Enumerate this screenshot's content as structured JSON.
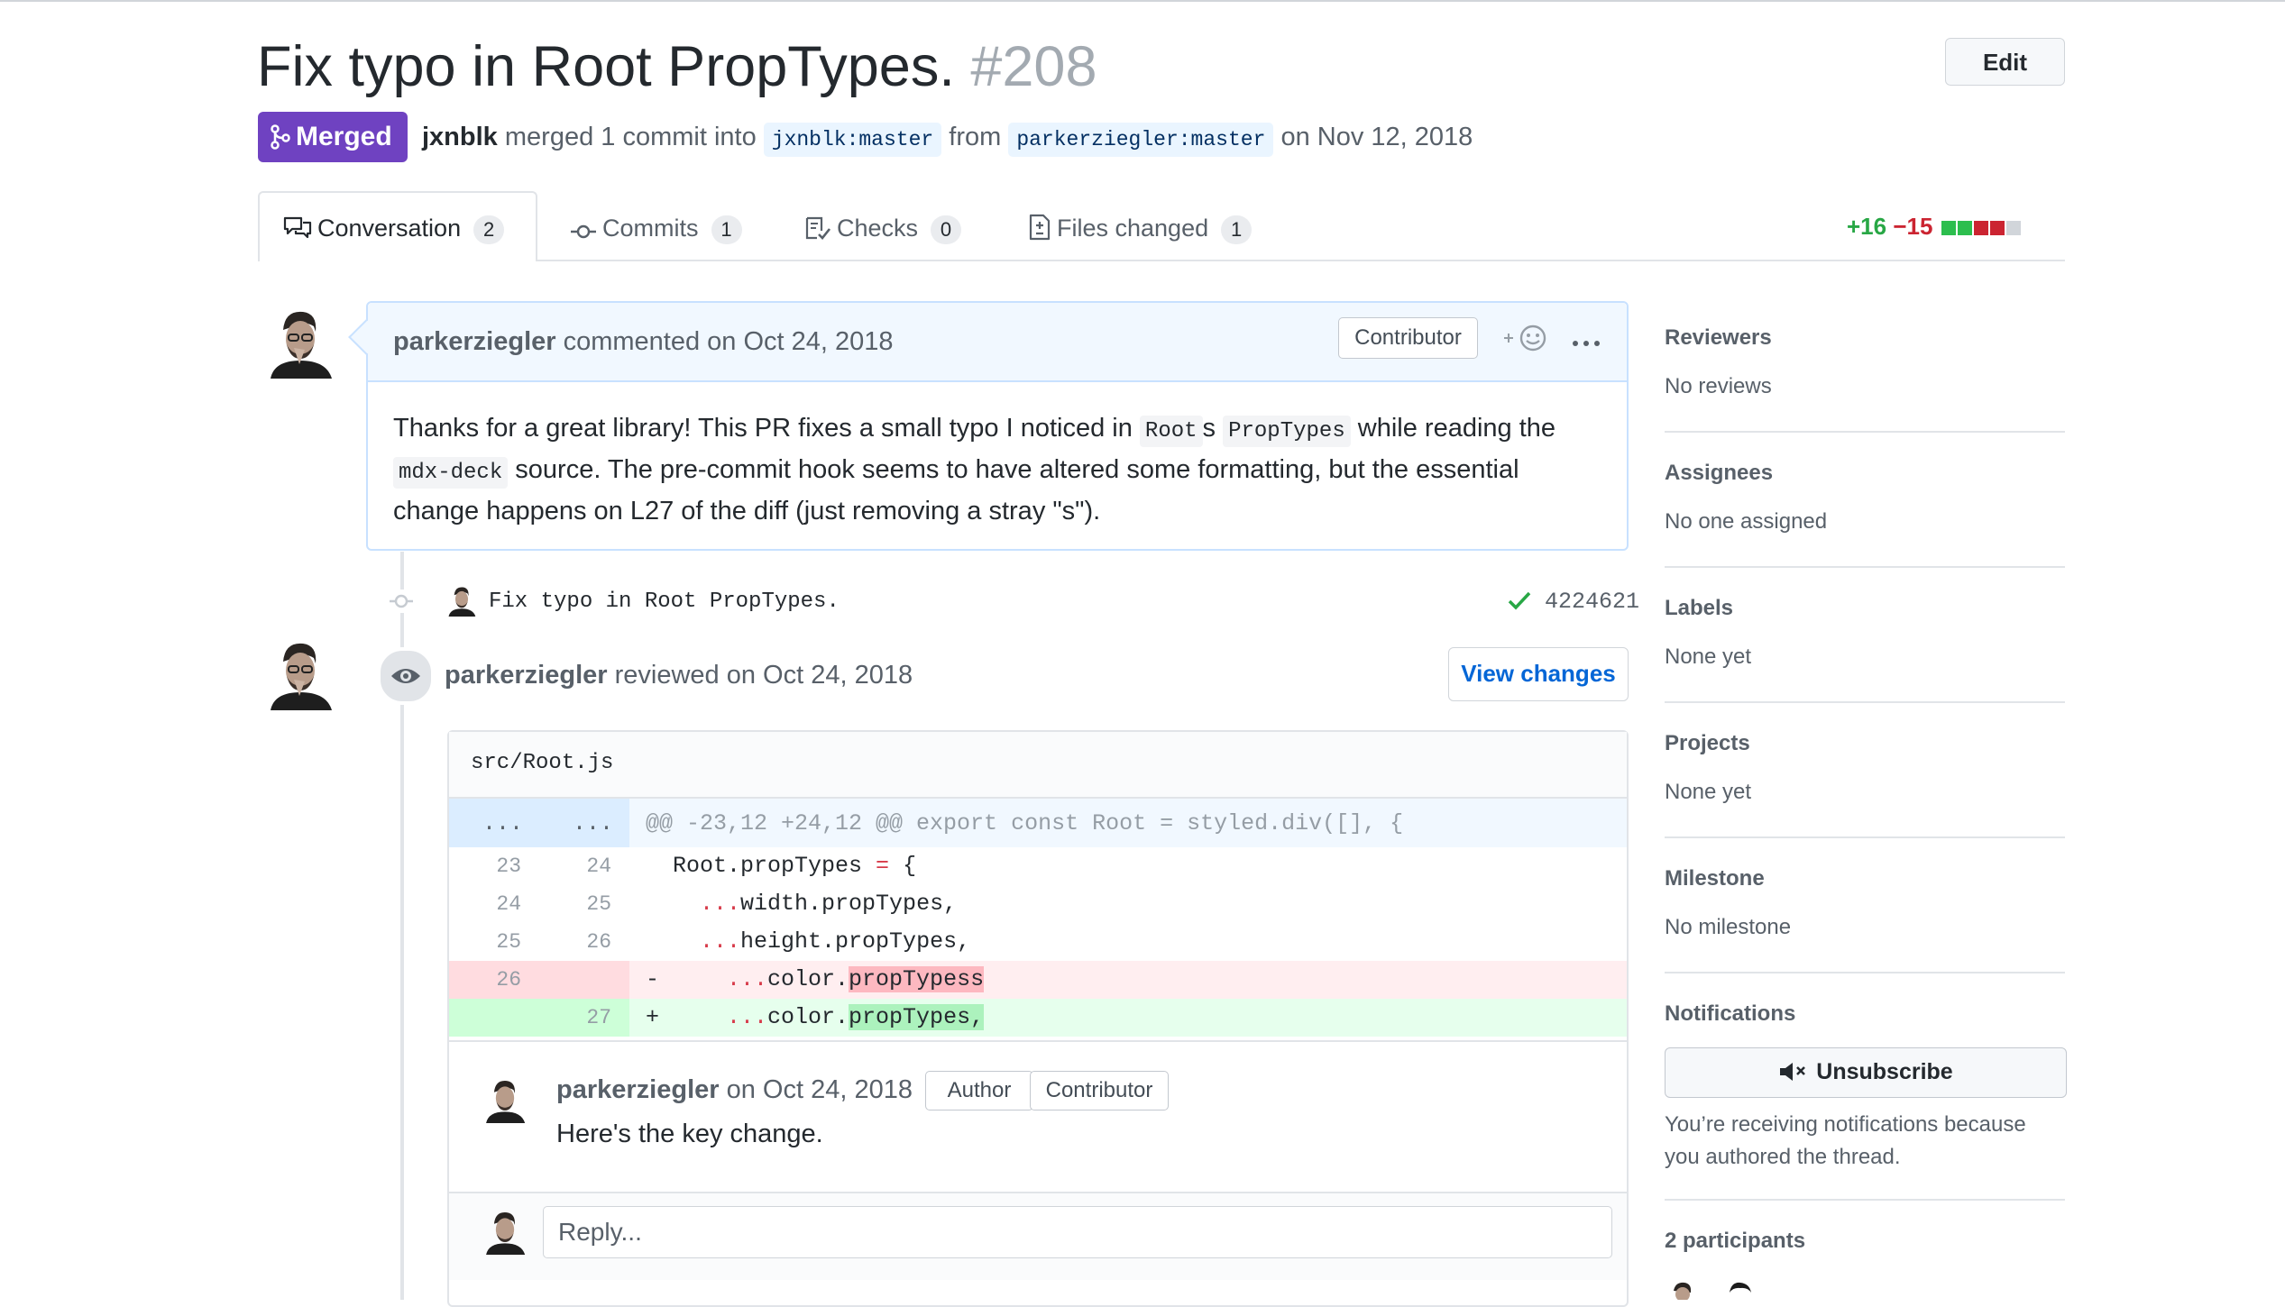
{
  "pr": {
    "title": "Fix typo in Root PropTypes.",
    "number": "#208",
    "edit_label": "Edit",
    "state_label": "Merged",
    "merger": "jxnblk",
    "merge_text": "merged 1 commit into",
    "base_branch": "jxnblk:master",
    "from_text": "from",
    "head_branch": "parkerziegler:master",
    "date_text": "on Nov 12, 2018"
  },
  "tabs": [
    {
      "label": "Conversation",
      "count": "2",
      "icon": "comment-discussion-icon"
    },
    {
      "label": "Commits",
      "count": "1",
      "icon": "git-commit-icon"
    },
    {
      "label": "Checks",
      "count": "0",
      "icon": "checklist-icon"
    },
    {
      "label": "Files changed",
      "count": "1",
      "icon": "file-diff-icon"
    }
  ],
  "diffstat": {
    "additions": "+16",
    "deletions": "−15"
  },
  "comment": {
    "author": "parkerziegler",
    "action": "commented on Oct 24, 2018",
    "label": "Contributor",
    "body_part1": "Thanks for a great library! This PR fixes a small typo I noticed in ",
    "code1": "Root",
    "body_part2": "s ",
    "code2": "PropTypes",
    "body_part3": " while reading the ",
    "code3": "mdx-deck",
    "body_part4": " source. The pre-commit hook seems to have altered some formatting, but the essential change happens on L27 of the diff (just removing a stray \"s\")."
  },
  "commit": {
    "message": "Fix typo in Root PropTypes.",
    "sha": "4224621"
  },
  "review": {
    "author": "parkerziegler",
    "action": "reviewed on Oct 24, 2018",
    "view_button": "View changes",
    "file_path": "src/Root.js",
    "hunk_left": "...",
    "hunk_right": "...",
    "hunk_header": "@@ -23,12 +24,12 @@ export const Root = styled.div([], {",
    "lines": [
      {
        "old": "23",
        "new": "24",
        "sign": "",
        "code": "  Root.propTypes = {"
      },
      {
        "old": "24",
        "new": "25",
        "sign": "",
        "code": "    ...width.propTypes,"
      },
      {
        "old": "25",
        "new": "26",
        "sign": "",
        "code": "    ...height.propTypes,"
      },
      {
        "old": "26",
        "new": "",
        "sign": "-",
        "code": "    ...color.propTypess"
      },
      {
        "old": "",
        "new": "27",
        "sign": "+",
        "code": "    ...color.propTypes,"
      }
    ],
    "inline_comment": {
      "author": "parkerziegler",
      "date": "on Oct 24, 2018",
      "labels": [
        "Author",
        "Contributor"
      ],
      "text": "Here's the key change."
    },
    "reply_placeholder": "Reply..."
  },
  "sidebar": {
    "reviewers": {
      "title": "Reviewers",
      "value": "No reviews"
    },
    "assignees": {
      "title": "Assignees",
      "value": "No one assigned"
    },
    "labels": {
      "title": "Labels",
      "value": "None yet"
    },
    "projects": {
      "title": "Projects",
      "value": "None yet"
    },
    "milestone": {
      "title": "Milestone",
      "value": "No milestone"
    },
    "notifications": {
      "title": "Notifications",
      "button": "Unsubscribe",
      "note": "You’re receiving notifications because you authored the thread."
    },
    "participants": {
      "title": "2 participants"
    }
  },
  "colors": {
    "merged": "#6f42c1",
    "addition": "#28a745",
    "deletion": "#cb2431",
    "link": "#0366d6",
    "del_bg": "#ffeef0",
    "add_bg": "#e6ffed"
  }
}
